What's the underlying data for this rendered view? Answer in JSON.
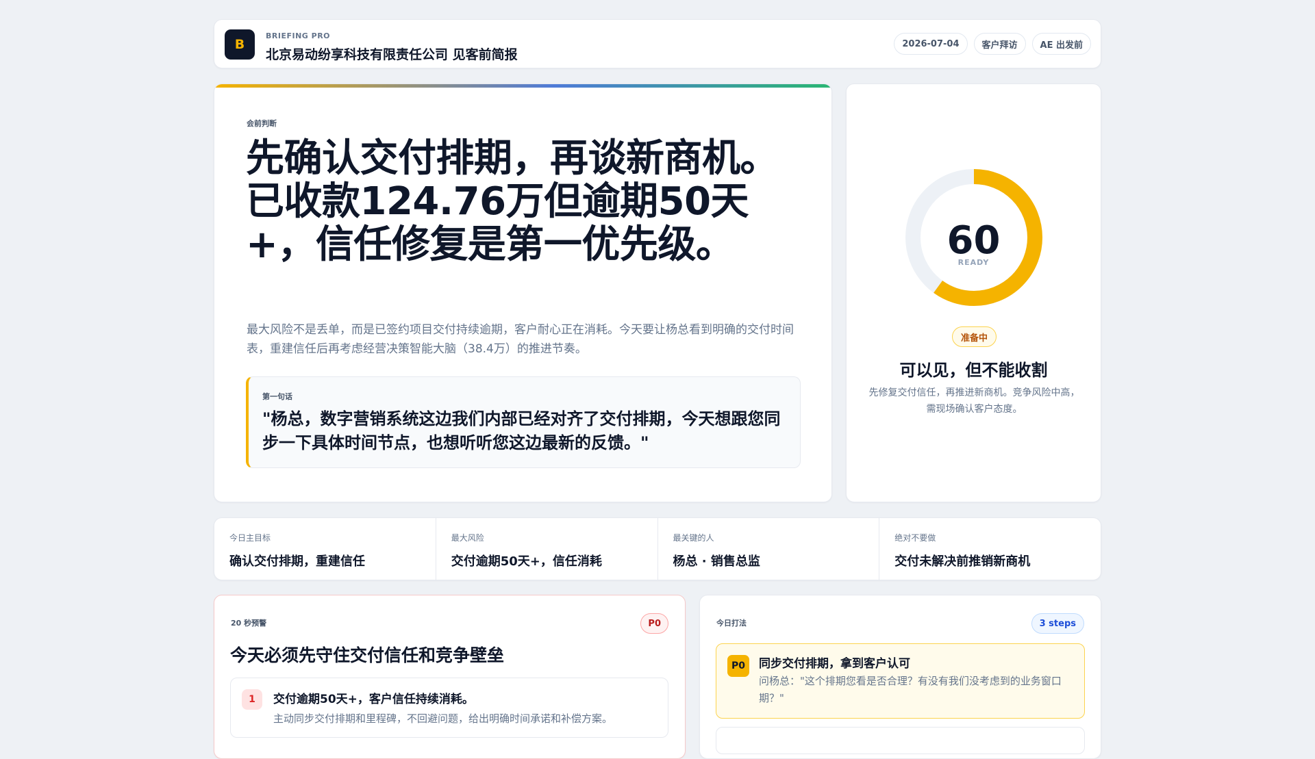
{
  "header": {
    "logo_letter": "B",
    "kicker": "BRIEFING PRO",
    "title": "北京易动纷享科技有限责任公司 见客前简报",
    "chips": [
      "2026-07-04",
      "客户拜访",
      "AE 出发前"
    ]
  },
  "judgement": {
    "kicker": "会前判断",
    "headline": "先确认交付排期，再谈新商机。已收款124.76万但逾期50天+，信任修复是第一优先级。",
    "description": "最大风险不是丢单，而是已签约项目交付持续逾期，客户耐心正在消耗。今天要让杨总看到明确的交付时间表，重建信任后再考虑经营决策智能大脑（38.4万）的推进节奏。",
    "first_line_kicker": "第一句话",
    "first_line": "\"杨总，数字营销系统这边我们内部已经对齐了交付排期，今天想跟您同步一下具体时间节点，也想听听您这边最新的反馈。\""
  },
  "readiness": {
    "score": "60",
    "score_value": 60,
    "score_label": "READY",
    "status": "准备中",
    "title": "可以见，但不能收割",
    "note": "先修复交付信任，再推进新商机。竞争风险中高，需现场确认客户态度。",
    "accent_color": "#f5b300",
    "track_color": "#edf1f6"
  },
  "summary": [
    {
      "label": "今日主目标",
      "value": "确认交付排期，重建信任"
    },
    {
      "label": "最大风险",
      "value": "交付逾期50天+，信任消耗"
    },
    {
      "label": "最关键的人",
      "value": "杨总 · 销售总监"
    },
    {
      "label": "绝对不要做",
      "value": "交付未解决前推销新商机"
    }
  ],
  "alert": {
    "kicker": "20 秒预警",
    "priority": "P0",
    "title": "今天必须先守住交付信任和竞争壁垒",
    "items": [
      {
        "num": "1",
        "title": "交付逾期50天+，客户信任持续消耗。",
        "detail": "主动同步交付排期和里程碑，不回避问题，给出明确时间承诺和补偿方案。"
      }
    ]
  },
  "plan": {
    "kicker": "今日打法",
    "steps_badge": "3 steps",
    "steps": [
      {
        "priority": "P0",
        "title": "同步交付排期，拿到客户认可",
        "detail": "问杨总：\"这个排期您看是否合理？有没有我们没考虑到的业务窗口期？\""
      }
    ]
  }
}
